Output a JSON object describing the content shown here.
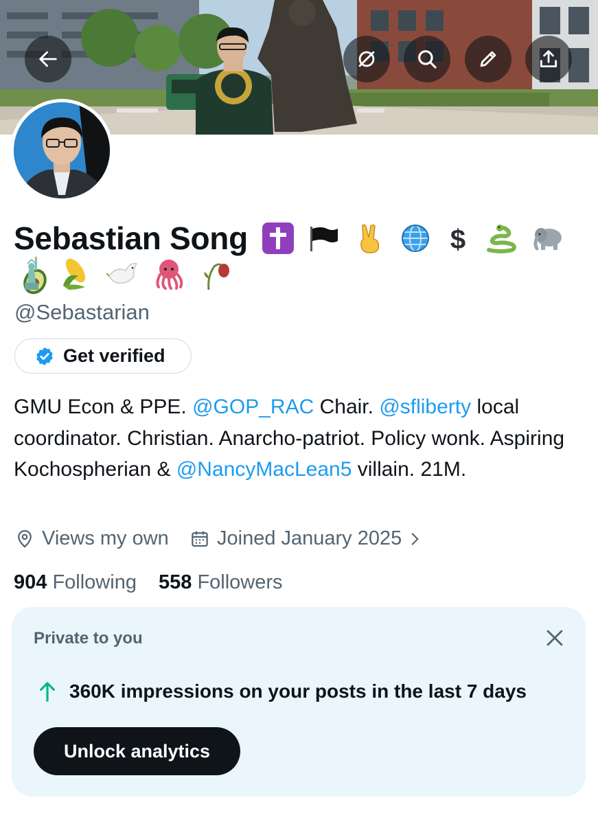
{
  "header": {
    "back_icon": "arrow-left-icon",
    "actions": [
      "grok-icon",
      "search-icon",
      "edit-icon",
      "share-icon"
    ]
  },
  "profile": {
    "name": "Sebastian Song",
    "name_emojis_row1": [
      "latin-cross",
      "black-flag",
      "victory-hand",
      "globe-with-meridians",
      "dollar-sign",
      "snake",
      "elephant",
      "avocado"
    ],
    "name_emojis_row2": [
      "statue-of-liberty",
      "ear-of-corn",
      "dove",
      "octopus",
      "wilted-flower"
    ],
    "handle": "@Sebastarian",
    "verify_label": "Get verified",
    "bio": {
      "p1": "GMU Econ & PPE. ",
      "m1": "@GOP_RAC",
      "p2": " Chair. ",
      "m2": "@sfliberty",
      "p3": " local coordinator. Christian. Anarcho-patriot. Policy wonk. Aspiring Kochospherian & ",
      "m3": "@NancyMacLean5",
      "p4": " villain. 21M."
    },
    "location": "Views my own",
    "joined": "Joined January 2025",
    "following_count": "904",
    "following_label": "Following",
    "followers_count": "558",
    "followers_label": "Followers"
  },
  "private_card": {
    "label": "Private to you",
    "stat": "360K impressions on your posts in the last 7 days",
    "button": "Unlock analytics"
  },
  "colors": {
    "accent": "#1d9bf0",
    "text": "#0f1419",
    "secondary": "#536471",
    "card_bg": "#eaf5fc",
    "stat_arrow": "#00ba7c"
  }
}
